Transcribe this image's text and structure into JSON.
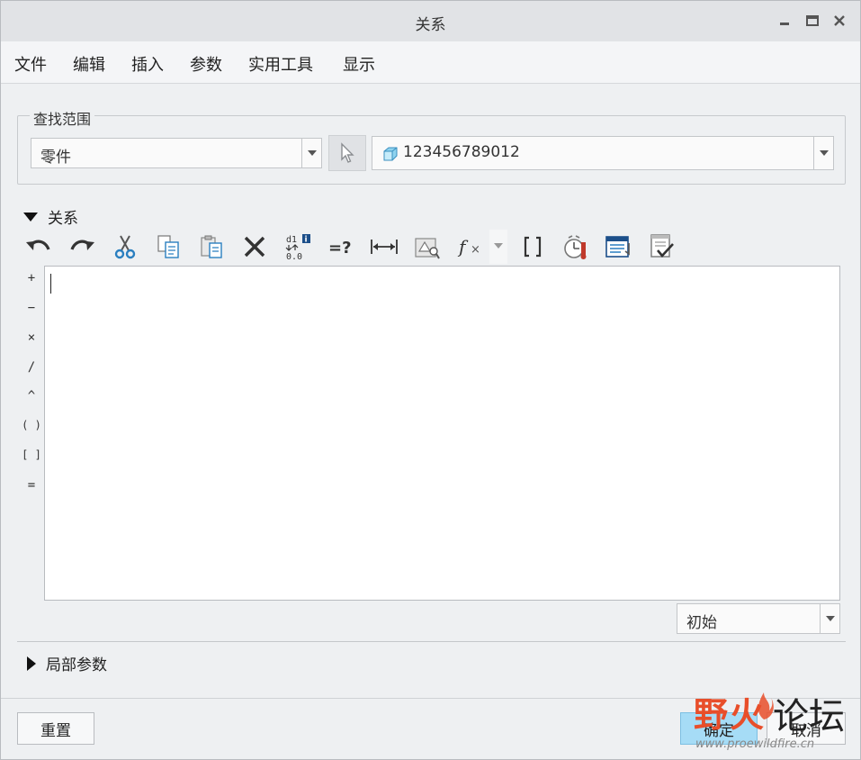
{
  "window": {
    "title": "关系"
  },
  "menu": [
    "文件",
    "编辑",
    "插入",
    "参数",
    "实用工具",
    "显示"
  ],
  "search": {
    "group_label": "查找范围",
    "scope_value": "零件",
    "model_value": "123456789012"
  },
  "relations": {
    "section_label": "关系",
    "toolbar_icons": [
      "undo-icon",
      "redo-icon",
      "cut-icon",
      "copy-icon",
      "paste-icon",
      "delete-icon",
      "switch-dimensions-icon",
      "evaluate-icon",
      "show-dimension-icon",
      "insert-parameter-icon",
      "insert-function-icon",
      "insert-parentheses-icon",
      "verify-relations-icon",
      "sort-relations-icon",
      "check-relations-icon"
    ],
    "operators": [
      "+",
      "−",
      "×",
      "/",
      "^",
      "( )",
      "[ ]",
      "="
    ],
    "editor_text": "",
    "status_value": "初始"
  },
  "local_params": {
    "section_label": "局部参数"
  },
  "footer": {
    "reset_label": "重置",
    "ok_label": "确定",
    "cancel_label": "取消"
  },
  "watermark": {
    "left_text": "野火",
    "right_text": "论坛",
    "url": "www.proewildfire.cn"
  },
  "colors": {
    "primary_button": "#a6dcf6",
    "watermark_accent": "#e84e2a"
  }
}
